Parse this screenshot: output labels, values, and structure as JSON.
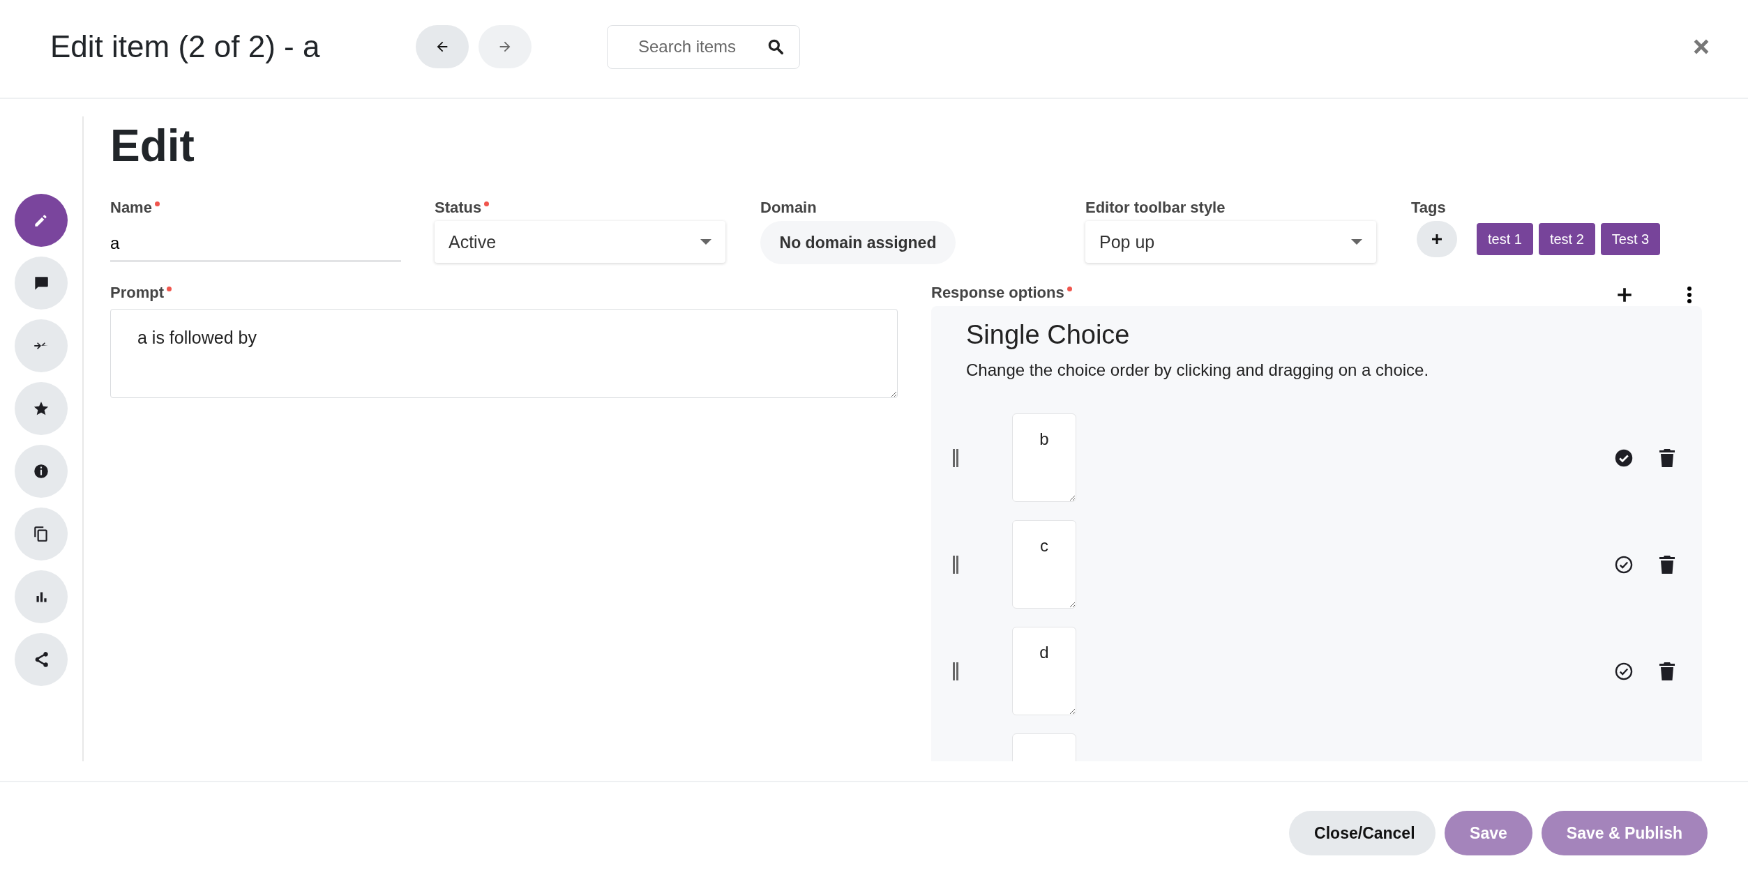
{
  "header": {
    "title": "Edit item (2 of 2) - a",
    "nav": [
      {
        "kind": "prev",
        "disabled": false
      },
      {
        "kind": "next",
        "disabled": true
      }
    ],
    "search": {
      "placeholder": "Search items"
    }
  },
  "sidebar": {
    "items": [
      {
        "kind": "edit",
        "selected": true
      },
      {
        "kind": "comment",
        "selected": false
      },
      {
        "kind": "merge",
        "selected": false
      },
      {
        "kind": "star",
        "selected": false
      },
      {
        "kind": "info",
        "selected": false
      },
      {
        "kind": "copy",
        "selected": false
      },
      {
        "kind": "chart",
        "selected": false
      },
      {
        "kind": "share",
        "selected": false
      }
    ]
  },
  "heading": "Edit",
  "fields": {
    "name": {
      "label": "Name",
      "required": true,
      "value": "a"
    },
    "status": {
      "label": "Status",
      "required": true,
      "value": "Active"
    },
    "domain": {
      "label": "Domain",
      "value": "No domain assigned"
    },
    "toolbar_style": {
      "label": "Editor toolbar style",
      "value": "Pop up"
    },
    "tags": {
      "label": "Tags",
      "items": [
        "test 1",
        "test 2",
        "Test 3"
      ]
    }
  },
  "prompt": {
    "label": "Prompt",
    "required": true,
    "value": "a is followed by"
  },
  "response_options": {
    "label": "Response options",
    "required": true,
    "title": "Single Choice",
    "hint": "Change the choice order by clicking and dragging on a choice.",
    "choices": [
      {
        "text": "b",
        "correct": true
      },
      {
        "text": "c",
        "correct": false
      },
      {
        "text": "d",
        "correct": false
      }
    ]
  },
  "footer": {
    "buttons": [
      {
        "label": "Close/Cancel",
        "kind": "secondary"
      },
      {
        "label": "Save",
        "kind": "primary"
      },
      {
        "label": "Save & Publish",
        "kind": "primary"
      }
    ]
  }
}
